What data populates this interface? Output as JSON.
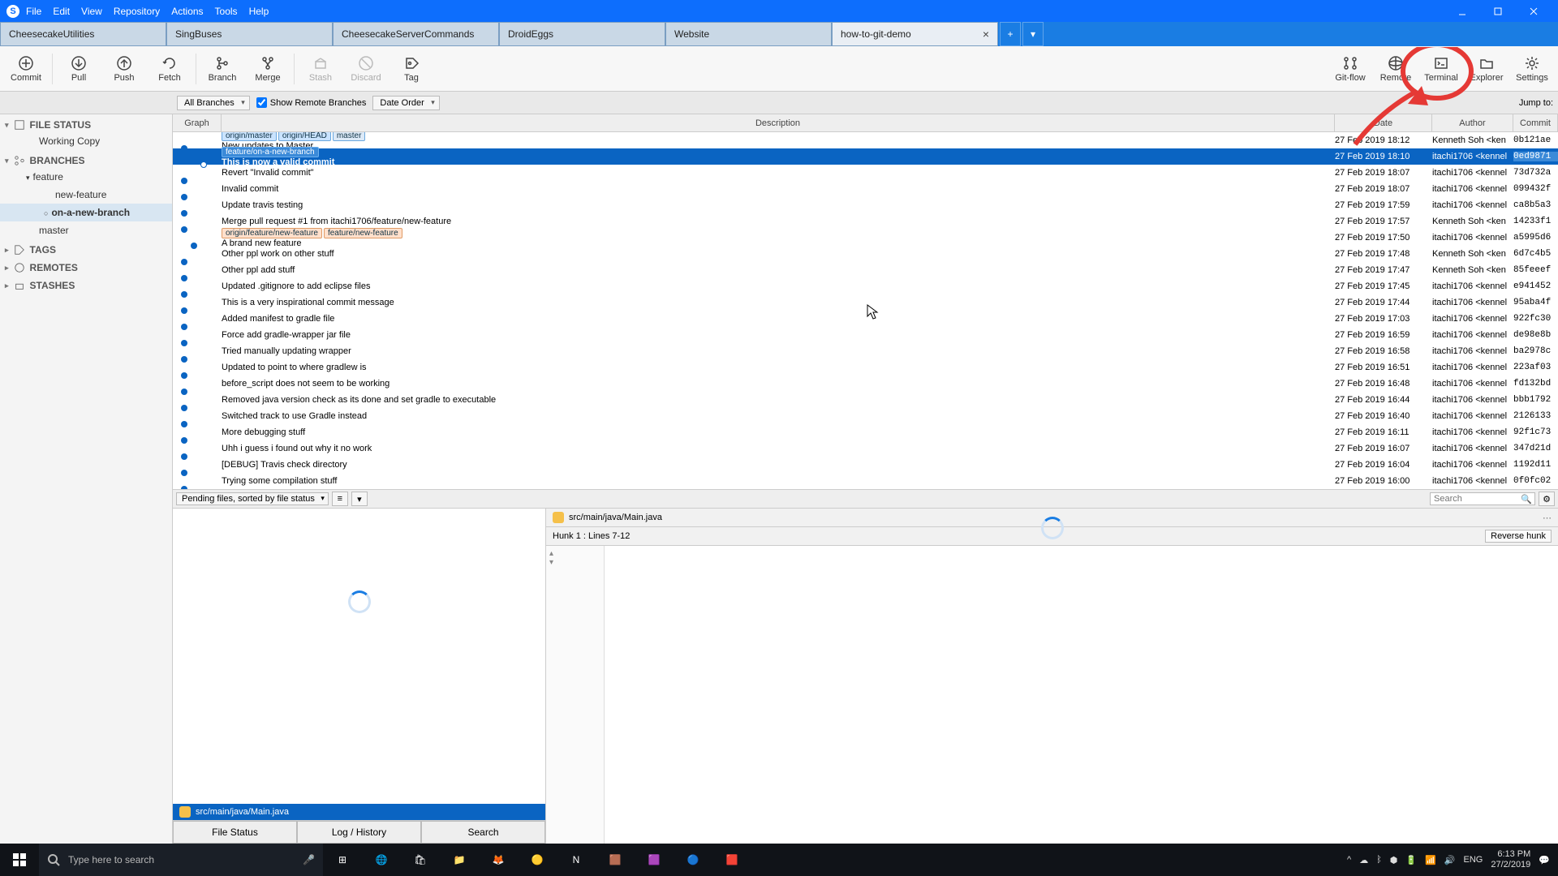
{
  "menu": [
    "File",
    "Edit",
    "View",
    "Repository",
    "Actions",
    "Tools",
    "Help"
  ],
  "tabs": [
    {
      "label": "CheesecakeUtilities"
    },
    {
      "label": "SingBuses"
    },
    {
      "label": "CheesecakeServerCommands"
    },
    {
      "label": "DroidEggs"
    },
    {
      "label": "Website"
    },
    {
      "label": "how-to-git-demo",
      "active": true
    }
  ],
  "toolbar": {
    "commit": "Commit",
    "pull": "Pull",
    "push": "Push",
    "fetch": "Fetch",
    "branch": "Branch",
    "merge": "Merge",
    "stash": "Stash",
    "discard": "Discard",
    "tag": "Tag",
    "gitflow": "Git-flow",
    "remote": "Remote",
    "terminal": "Terminal",
    "explorer": "Explorer",
    "settings": "Settings"
  },
  "filter": {
    "branches": "All Branches",
    "showremote": "Show Remote Branches",
    "order": "Date Order",
    "jump": "Jump to:"
  },
  "sidebar": {
    "filestatus": "FILE STATUS",
    "workingcopy": "Working Copy",
    "branches": "BRANCHES",
    "feature": "feature",
    "newfeature": "new-feature",
    "onnew": "on-a-new-branch",
    "master": "master",
    "tags": "TAGS",
    "remotes": "REMOTES",
    "stashes": "STASHES"
  },
  "columns": {
    "graph": "Graph",
    "desc": "Description",
    "date": "Date",
    "author": "Author",
    "commit": "Commit"
  },
  "commits": [
    {
      "dotx": 10,
      "labels": [
        {
          "t": "origin/master"
        },
        {
          "t": "origin/HEAD"
        },
        {
          "t": "master",
          "cls": "local"
        }
      ],
      "desc": "New updates to Master",
      "date": "27 Feb 2019 18:12",
      "auth": "Kenneth Soh <ken",
      "hash": "0b121ae"
    },
    {
      "dotx": 34,
      "sel": true,
      "labels": [
        {
          "t": "feature/on-a-new-branch",
          "cls": "local"
        }
      ],
      "desc": "This is now a valid commit",
      "date": "27 Feb 2019 18:10",
      "auth": "itachi1706 <kennel",
      "hash": "0ed9871"
    },
    {
      "dotx": 10,
      "desc": "Revert \"Invalid commit\"",
      "date": "27 Feb 2019 18:07",
      "auth": "itachi1706 <kennel",
      "hash": "73d732a"
    },
    {
      "dotx": 10,
      "desc": "Invalid commit",
      "date": "27 Feb 2019 18:07",
      "auth": "itachi1706 <kennel",
      "hash": "099432f"
    },
    {
      "dotx": 10,
      "desc": "Update travis testing",
      "date": "27 Feb 2019 17:59",
      "auth": "itachi1706 <kennel",
      "hash": "ca8b5a3"
    },
    {
      "dotx": 10,
      "desc": "Merge pull request #1 from itachi1706/feature/new-feature",
      "date": "27 Feb 2019 17:57",
      "auth": "Kenneth Soh <ken",
      "hash": "14233f1"
    },
    {
      "dotx": 22,
      "labels": [
        {
          "t": "origin/feature/new-feature",
          "cls": "orange"
        },
        {
          "t": "feature/new-feature",
          "cls": "orange"
        }
      ],
      "desc": "A brand new feature",
      "date": "27 Feb 2019 17:50",
      "auth": "itachi1706 <kennel",
      "hash": "a5995d6"
    },
    {
      "dotx": 10,
      "desc": "Other ppl work on other stuff",
      "date": "27 Feb 2019 17:48",
      "auth": "Kenneth Soh <ken",
      "hash": "6d7c4b5"
    },
    {
      "dotx": 10,
      "desc": "Other ppl add stuff",
      "date": "27 Feb 2019 17:47",
      "auth": "Kenneth Soh <ken",
      "hash": "85feeef"
    },
    {
      "dotx": 10,
      "desc": "Updated .gitignore to add eclipse files",
      "date": "27 Feb 2019 17:45",
      "auth": "itachi1706 <kennel",
      "hash": "e941452"
    },
    {
      "dotx": 10,
      "desc": "This is a very inspirational commit message",
      "date": "27 Feb 2019 17:44",
      "auth": "itachi1706 <kennel",
      "hash": "95aba4f"
    },
    {
      "dotx": 10,
      "desc": "Added manifest to gradle file",
      "date": "27 Feb 2019 17:03",
      "auth": "itachi1706 <kennel",
      "hash": "922fc30"
    },
    {
      "dotx": 10,
      "desc": "Force add gradle-wrapper jar file",
      "date": "27 Feb 2019 16:59",
      "auth": "itachi1706 <kennel",
      "hash": "de98e8b"
    },
    {
      "dotx": 10,
      "desc": "Tried manually updating wrapper",
      "date": "27 Feb 2019 16:58",
      "auth": "itachi1706 <kennel",
      "hash": "ba2978c"
    },
    {
      "dotx": 10,
      "desc": "Updated to point to where gradlew is",
      "date": "27 Feb 2019 16:51",
      "auth": "itachi1706 <kennel",
      "hash": "223af03"
    },
    {
      "dotx": 10,
      "desc": "before_script does not seem to be working",
      "date": "27 Feb 2019 16:48",
      "auth": "itachi1706 <kennel",
      "hash": "fd132bd"
    },
    {
      "dotx": 10,
      "desc": "Removed java version check as its done and set gradle to executable",
      "date": "27 Feb 2019 16:44",
      "auth": "itachi1706 <kennel",
      "hash": "bbb1792"
    },
    {
      "dotx": 10,
      "desc": "Switched track to use Gradle instead",
      "date": "27 Feb 2019 16:40",
      "auth": "itachi1706 <kennel",
      "hash": "2126133"
    },
    {
      "dotx": 10,
      "desc": "More debugging stuff",
      "date": "27 Feb 2019 16:11",
      "auth": "itachi1706 <kennel",
      "hash": "92f1c73"
    },
    {
      "dotx": 10,
      "desc": "Uhh i guess i found out why it no work",
      "date": "27 Feb 2019 16:07",
      "auth": "itachi1706 <kennel",
      "hash": "347d21d"
    },
    {
      "dotx": 10,
      "desc": "[DEBUG] Travis check directory",
      "date": "27 Feb 2019 16:04",
      "auth": "itachi1706 <kennel",
      "hash": "1192d11"
    },
    {
      "dotx": 10,
      "desc": "Trying some compilation stuff",
      "date": "27 Feb 2019 16:00",
      "auth": "itachi1706 <kennel",
      "hash": "0f0fc02"
    }
  ],
  "pending": {
    "sort": "Pending files, sorted by file status",
    "file": "src/main/java/Main.java"
  },
  "diff": {
    "file": "src/main/java/Main.java",
    "hunk": "Hunk 1 : Lines 7-12",
    "reverse": "Reverse hunk"
  },
  "paneltabs": {
    "status": "File Status",
    "log": "Log / History",
    "search": "Search"
  },
  "search_placeholder": "Search",
  "taskbar": {
    "search": "Type here to search",
    "time": "6:13 PM",
    "date": "27/2/2019",
    "lang": "ENG"
  }
}
